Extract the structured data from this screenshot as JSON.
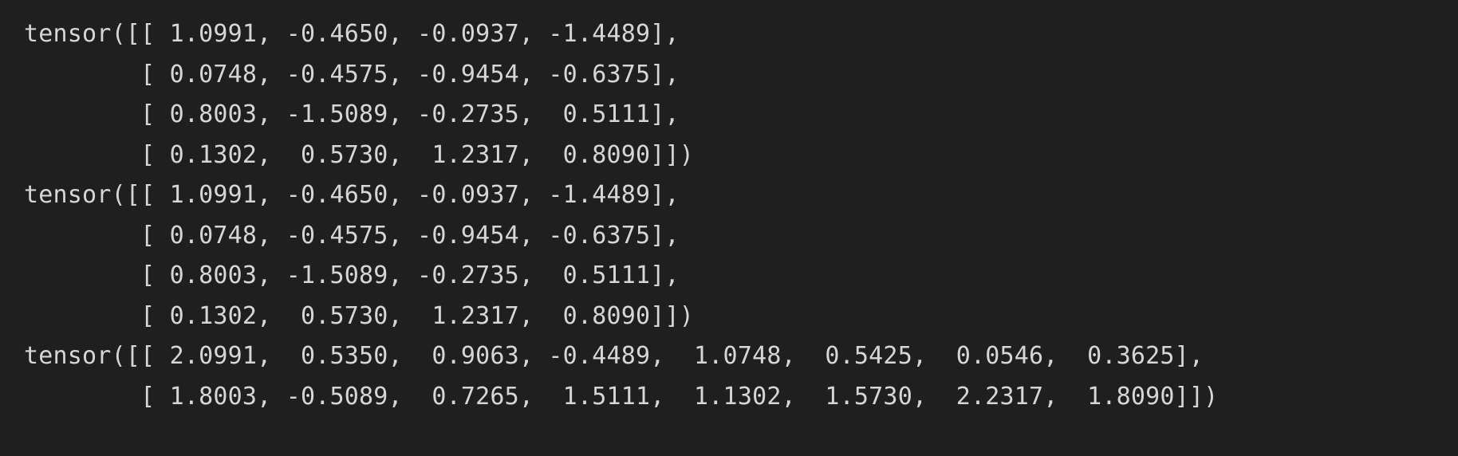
{
  "output": {
    "lines": [
      "tensor([[ 1.0991, -0.4650, -0.0937, -1.4489],",
      "        [ 0.0748, -0.4575, -0.9454, -0.6375],",
      "        [ 0.8003, -1.5089, -0.2735,  0.5111],",
      "        [ 0.1302,  0.5730,  1.2317,  0.8090]])",
      "tensor([[ 1.0991, -0.4650, -0.0937, -1.4489],",
      "        [ 0.0748, -0.4575, -0.9454, -0.6375],",
      "        [ 0.8003, -1.5089, -0.2735,  0.5111],",
      "        [ 0.1302,  0.5730,  1.2317,  0.8090]])",
      "tensor([[ 2.0991,  0.5350,  0.9063, -0.4489,  1.0748,  0.5425,  0.0546,  0.3625],",
      "        [ 1.8003, -0.5089,  0.7265,  1.5111,  1.1302,  1.5730,  2.2317,  1.8090]])"
    ]
  },
  "colors": {
    "background": "#1f1f1f",
    "text": "#d6d6d6"
  }
}
